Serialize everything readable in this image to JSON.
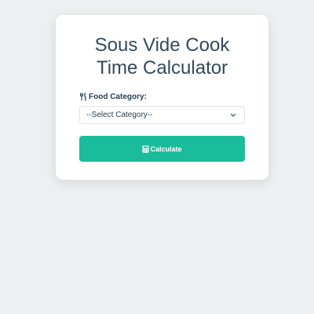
{
  "card": {
    "title_line1": "Sous Vide Cook",
    "title_line2": "Time Calculator"
  },
  "form": {
    "category_label": "Food Category:",
    "category_label_icon": "utensils-icon",
    "category_select": {
      "selected": "--Select Category--"
    },
    "calculate_button": {
      "label": "Calculate",
      "icon": "calculator-icon"
    }
  },
  "colors": {
    "background": "#ecf0f1",
    "accent": "#1abc9c",
    "text": "#2c3e50"
  }
}
